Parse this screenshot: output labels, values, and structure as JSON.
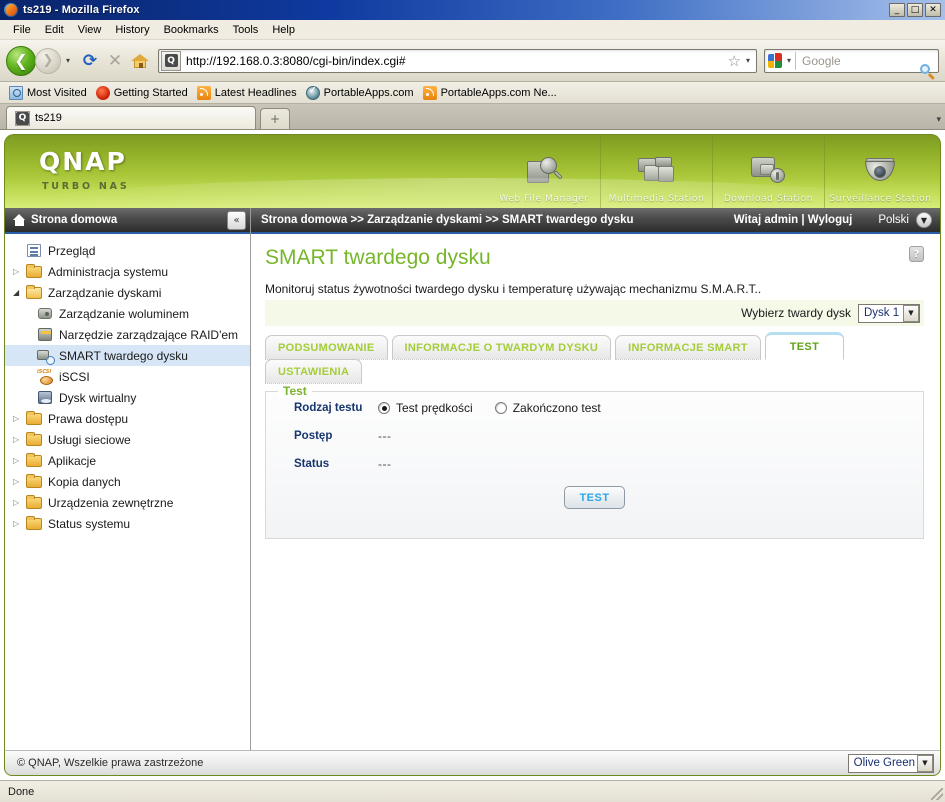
{
  "browser": {
    "title": "ts219 - Mozilla Firefox",
    "window_buttons": {
      "minimize": "_",
      "maximize": "□",
      "close": "✕"
    },
    "menus": [
      "File",
      "Edit",
      "View",
      "History",
      "Bookmarks",
      "Tools",
      "Help"
    ],
    "url": "http://192.168.0.3:8080/cgi-bin/index.cgi#",
    "search_placeholder": "Google",
    "bookmarks": [
      {
        "label": "Most Visited",
        "icon": "most-visited-icon"
      },
      {
        "label": "Getting Started",
        "icon": "firefox-icon"
      },
      {
        "label": "Latest Headlines",
        "icon": "rss-feed-icon"
      },
      {
        "label": "PortableApps.com",
        "icon": "portableapps-icon"
      },
      {
        "label": "PortableApps.com Ne...",
        "icon": "rss-feed-icon"
      }
    ],
    "tab": {
      "label": "ts219"
    },
    "newtab_label": "+",
    "tabstrip_caret": "▾",
    "status_text": "Done",
    "back_glyph": "❮",
    "forward_glyph": "❯",
    "reload_glyph": "⟳",
    "stop_glyph": "✕",
    "star_glyph": "☆",
    "caret_glyph": "▾"
  },
  "banner": {
    "logo": "QNAP",
    "tagline": "TURBO NAS",
    "stations": [
      {
        "label": "Web File Manager",
        "icon": "web-file-manager-icon"
      },
      {
        "label": "Multimedia Station",
        "icon": "multimedia-station-icon"
      },
      {
        "label": "Download Station",
        "icon": "download-station-icon"
      },
      {
        "label": "Surveillance Station",
        "icon": "surveillance-station-icon"
      }
    ]
  },
  "sidebar": {
    "header": "Strona domowa",
    "collapse_glyph": "«",
    "items": [
      {
        "label": "Przegląd",
        "icon": "overview-icon",
        "level": 1,
        "arrow": "",
        "selected": false
      },
      {
        "label": "Administracja systemu",
        "icon": "folder-icon",
        "level": 1,
        "arrow": "▷",
        "selected": false
      },
      {
        "label": "Zarządzanie dyskami",
        "icon": "folder-open-icon",
        "level": 1,
        "arrow": "◢",
        "selected": false
      },
      {
        "label": "Zarządzanie woluminem",
        "icon": "volume-icon",
        "level": 2,
        "arrow": "",
        "selected": false
      },
      {
        "label": "Narzędzie zarządzające RAID'em",
        "icon": "raid-icon",
        "level": 2,
        "arrow": "",
        "selected": false
      },
      {
        "label": "SMART twardego dysku",
        "icon": "smart-icon",
        "level": 2,
        "arrow": "",
        "selected": true
      },
      {
        "label": "iSCSI",
        "icon": "iscsi-icon",
        "level": 2,
        "arrow": "",
        "selected": false
      },
      {
        "label": "Dysk wirtualny",
        "icon": "virtual-disk-icon",
        "level": 2,
        "arrow": "",
        "selected": false
      },
      {
        "label": "Prawa dostępu",
        "icon": "folder-icon",
        "level": 1,
        "arrow": "▷",
        "selected": false
      },
      {
        "label": "Usługi sieciowe",
        "icon": "folder-icon",
        "level": 1,
        "arrow": "▷",
        "selected": false
      },
      {
        "label": "Aplikacje",
        "icon": "folder-icon",
        "level": 1,
        "arrow": "▷",
        "selected": false
      },
      {
        "label": "Kopia danych",
        "icon": "folder-icon",
        "level": 1,
        "arrow": "▷",
        "selected": false
      },
      {
        "label": "Urządzenia zewnętrzne",
        "icon": "folder-icon",
        "level": 1,
        "arrow": "▷",
        "selected": false
      },
      {
        "label": "Status systemu",
        "icon": "folder-icon",
        "level": 1,
        "arrow": "▷",
        "selected": false
      }
    ]
  },
  "topbar": {
    "breadcrumb": "Strona domowa >> Zarządzanie dyskami >> SMART twardego dysku",
    "welcome": "Witaj admin | Wyloguj",
    "language": "Polski",
    "language_caret": "▼"
  },
  "page": {
    "title": "SMART twardego dysku",
    "help_glyph": "?",
    "intro": "Monitoruj status żywotności twardego dysku i temperaturę używając mechanizmu S.M.A.R.T..",
    "disk_select_label": "Wybierz twardy dysk",
    "disk_selected": "Dysk 1",
    "select_caret": "▼",
    "tabs": [
      {
        "label": "PODSUMOWANIE",
        "active": false
      },
      {
        "label": "INFORMACJE O TWARDYM DYSKU",
        "active": false
      },
      {
        "label": "INFORMACJE SMART",
        "active": false
      },
      {
        "label": "TEST",
        "active": true
      }
    ],
    "tabs_row2": [
      {
        "label": "USTAWIENIA",
        "active": false
      }
    ],
    "panel": {
      "legend": "Test",
      "rows": [
        {
          "label": "Rodzaj testu",
          "type": "radio"
        },
        {
          "label": "Postęp",
          "value": "---"
        },
        {
          "label": "Status",
          "value": "---"
        }
      ],
      "radio_options": [
        {
          "label": "Test prędkości",
          "checked": true
        },
        {
          "label": "Zakończono test",
          "checked": false
        }
      ],
      "button": "TEST"
    }
  },
  "footer": {
    "copyright": "© QNAP, Wszelkie prawa zastrzeżone",
    "theme": "Olive Green",
    "theme_caret": "▼"
  },
  "colors": {
    "qnap_green": "#a6c436",
    "title_green": "#76b72a",
    "tab_green": "#a5cd3a",
    "active_tab_green": "#5fa318",
    "label_navy": "#17366e",
    "button_blue": "#2aa8e8",
    "titlebar_blue": "#0a246a"
  }
}
